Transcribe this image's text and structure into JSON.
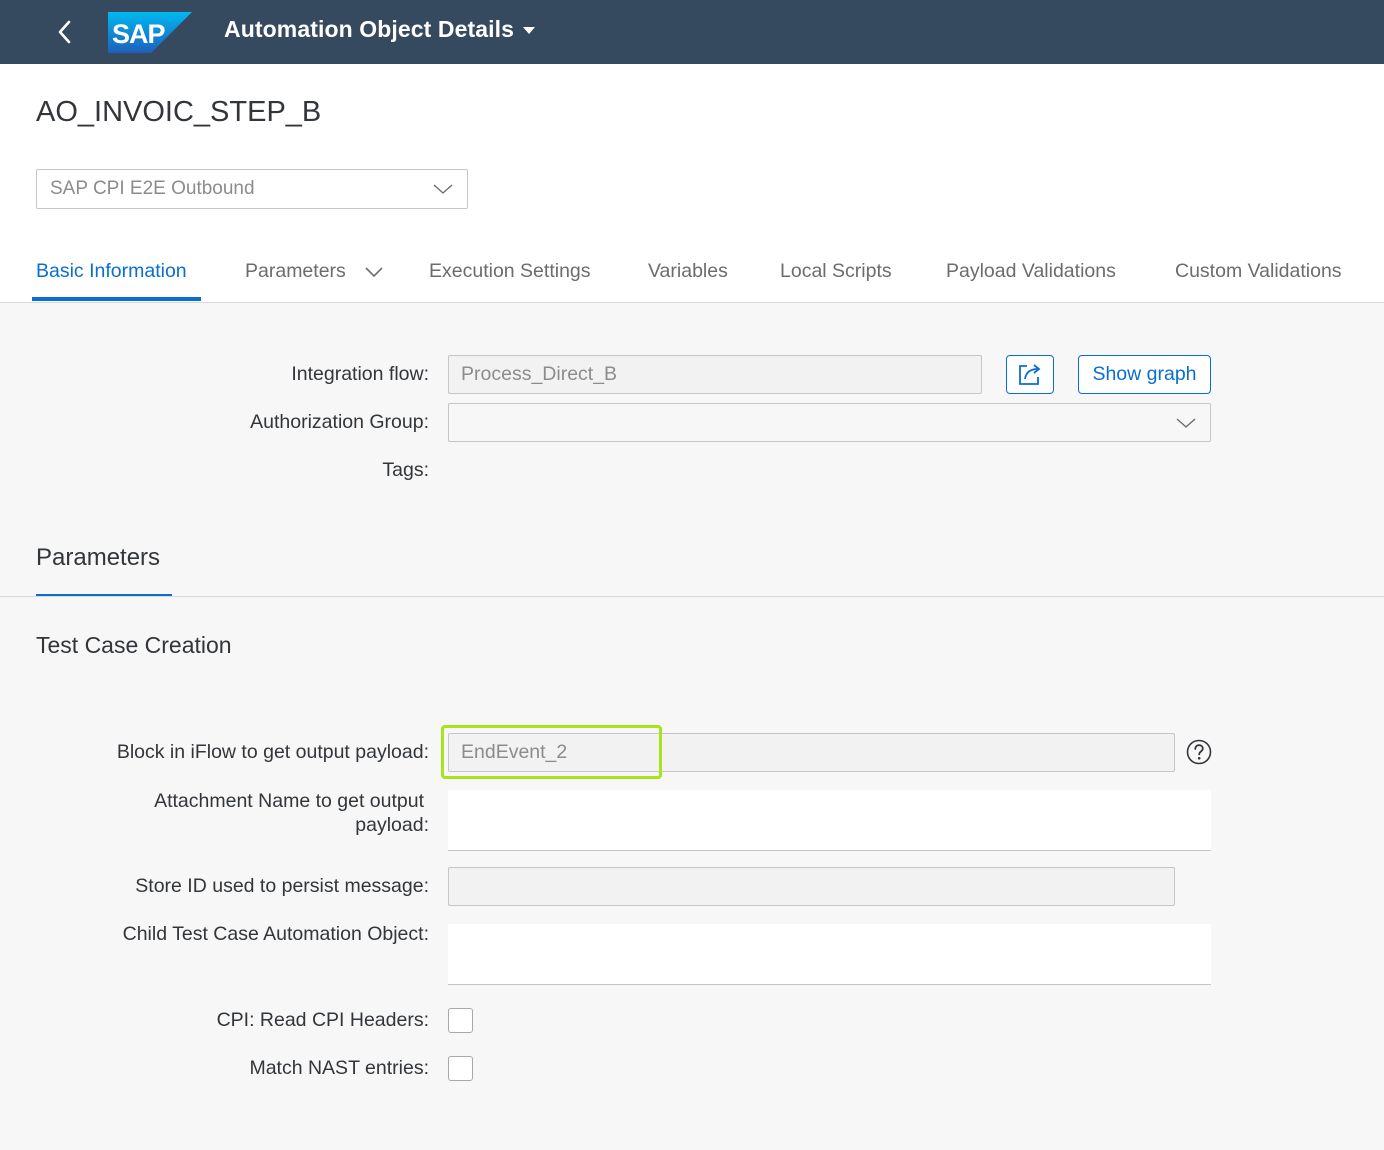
{
  "shell": {
    "title": "Automation Object Details",
    "logo_text": "SAP",
    "brand_color": "#354a5f"
  },
  "header": {
    "object_title": "AO_INVOIC_STEP_B",
    "variant": "SAP CPI E2E Outbound"
  },
  "tabs": [
    {
      "label": "Basic Information",
      "active": true
    },
    {
      "label": "Parameters",
      "has_dropdown": true
    },
    {
      "label": "Execution Settings"
    },
    {
      "label": "Variables"
    },
    {
      "label": "Local Scripts"
    },
    {
      "label": "Payload Validations"
    },
    {
      "label": "Custom Validations"
    }
  ],
  "basic": {
    "integration_flow_label": "Integration flow:",
    "integration_flow_value": "Process_Direct_B",
    "authorization_group_label": "Authorization Group:",
    "authorization_group_value": "",
    "tags_label": "Tags:",
    "show_graph_label": "Show graph"
  },
  "parameters": {
    "section_title": "Parameters",
    "subsection_title": "Test Case Creation",
    "block_label": "Block in iFlow to get output payload:",
    "block_value": "EndEvent_2",
    "attachment_label_line1": "Attachment Name to get output",
    "attachment_label_line2": "payload:",
    "attachment_value": "",
    "store_id_label": "Store ID used to persist message:",
    "store_id_value": "",
    "child_ao_label": "Child Test Case Automation Object:",
    "child_ao_value": "",
    "read_headers_label": "CPI: Read CPI Headers:",
    "read_headers_checked": false,
    "match_nast_label": "Match NAST entries:",
    "match_nast_checked": false
  },
  "colors": {
    "accent": "#0a6ed1",
    "highlight": "#a8e41c"
  }
}
